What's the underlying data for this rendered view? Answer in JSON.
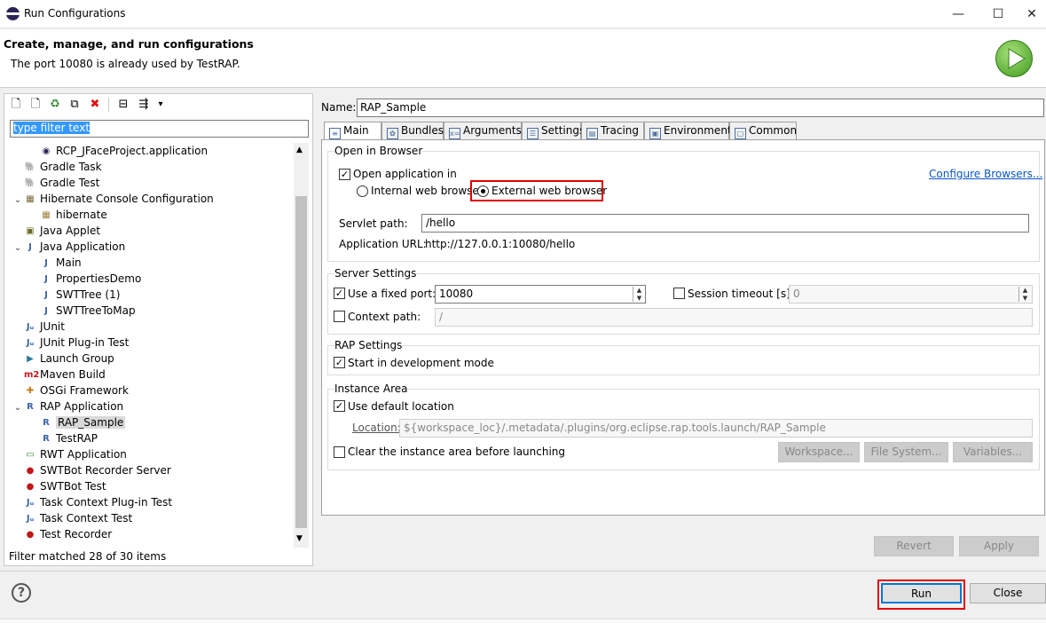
{
  "window": {
    "title": "Run Configurations",
    "minimize": "—",
    "maximize": "☐",
    "close": "✕"
  },
  "header": {
    "title": "Create, manage, and run configurations",
    "message": "The port 10080 is already used by TestRAP."
  },
  "filter": {
    "value": "type filter text"
  },
  "toolbar": {
    "menu_glyph": "▾"
  },
  "tree": [
    {
      "label": "RCP_JFaceProject.application",
      "icon": "eclipse-icon",
      "level": 2
    },
    {
      "label": "Gradle Task",
      "icon": "gradle-icon",
      "level": 1
    },
    {
      "label": "Gradle Test",
      "icon": "gradle-icon",
      "level": 1
    },
    {
      "label": "Hibernate Console Configuration",
      "icon": "hibernate-icon",
      "level": 1,
      "expanded": true
    },
    {
      "label": "hibernate",
      "icon": "hibernate-config-icon",
      "level": 2
    },
    {
      "label": "Java Applet",
      "icon": "applet-icon",
      "level": 1
    },
    {
      "label": "Java Application",
      "icon": "java-app-icon",
      "level": 1,
      "expanded": true
    },
    {
      "label": "Main",
      "icon": "java-app-icon",
      "level": 2
    },
    {
      "label": "PropertiesDemo",
      "icon": "java-app-icon",
      "level": 2
    },
    {
      "label": "SWTTree (1)",
      "icon": "java-app-icon",
      "level": 2
    },
    {
      "label": "SWTTreeToMap",
      "icon": "java-app-icon",
      "level": 2
    },
    {
      "label": "JUnit",
      "icon": "junit-icon",
      "level": 1
    },
    {
      "label": "JUnit Plug-in Test",
      "icon": "junit-plugin-icon",
      "level": 1
    },
    {
      "label": "Launch Group",
      "icon": "launch-group-icon",
      "level": 1
    },
    {
      "label": "Maven Build",
      "icon": "maven-icon",
      "level": 1
    },
    {
      "label": "OSGi Framework",
      "icon": "osgi-icon",
      "level": 1
    },
    {
      "label": "RAP Application",
      "icon": "rap-icon",
      "level": 1,
      "expanded": true
    },
    {
      "label": "RAP_Sample",
      "icon": "rap-icon",
      "level": 2,
      "selected": true
    },
    {
      "label": "TestRAP",
      "icon": "rap-icon",
      "level": 2
    },
    {
      "label": "RWT Application",
      "icon": "rwt-icon",
      "level": 1
    },
    {
      "label": "SWTBot Recorder Server",
      "icon": "swtbot-icon",
      "level": 1
    },
    {
      "label": "SWTBot Test",
      "icon": "swtbot-icon",
      "level": 1
    },
    {
      "label": "Task Context Plug-in Test",
      "icon": "junit-plugin-icon",
      "level": 1
    },
    {
      "label": "Task Context Test",
      "icon": "junit-icon",
      "level": 1
    },
    {
      "label": "Test Recorder",
      "icon": "swtbot-icon",
      "level": 1
    }
  ],
  "filter_status": "Filter matched 28 of 30 items",
  "name": {
    "label": "Name:",
    "value": "RAP_Sample"
  },
  "tabs": [
    {
      "label": "Main",
      "active": true
    },
    {
      "label": "Bundles"
    },
    {
      "label": "Arguments"
    },
    {
      "label": "Settings"
    },
    {
      "label": "Tracing"
    },
    {
      "label": "Environment"
    },
    {
      "label": "Common"
    }
  ],
  "browser": {
    "group": "Open in Browser",
    "open_in_label": "Open application in",
    "internal_label": "Internal web browser",
    "external_label": "External web browser",
    "configure_link": "Configure Browsers...",
    "servlet_label": "Servlet path:",
    "servlet_value": "/hello",
    "url_label": "Application URL:",
    "url_value": "http://127.0.0.1:10080/hello"
  },
  "server": {
    "group": "Server Settings",
    "fixed_port_label": "Use a fixed port:",
    "port_value": "10080",
    "session_label": "Session timeout [s]:",
    "session_value": "0",
    "context_label": "Context path:",
    "context_value": "/"
  },
  "rap": {
    "group": "RAP Settings",
    "dev_mode_label": "Start in development mode"
  },
  "instance": {
    "group": "Instance Area",
    "default_label": "Use default location",
    "location_label": "Location:",
    "location_value": "${workspace_loc}/.metadata/.plugins/org.eclipse.rap.tools.launch/RAP_Sample",
    "clear_label": "Clear the instance area before launching",
    "workspace_btn": "Workspace...",
    "filesystem_btn": "File System...",
    "variables_btn": "Variables..."
  },
  "actions": {
    "revert": "Revert",
    "apply": "Apply",
    "run": "Run",
    "close": "Close",
    "help": "?"
  },
  "colors": {
    "highlight_box": "#e00000",
    "selection": "#3399ff",
    "link": "#0b56c4"
  }
}
